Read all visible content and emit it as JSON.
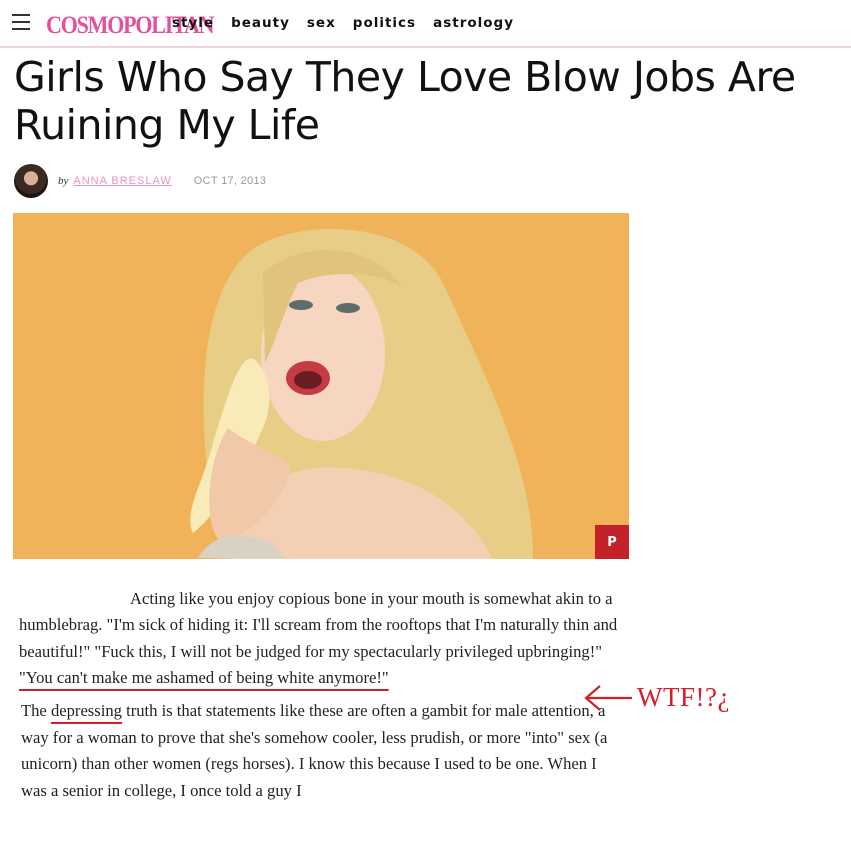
{
  "header": {
    "logo": "COSMOPOLITAN",
    "nav": [
      "style",
      "beauty",
      "sex",
      "politics",
      "astrology"
    ]
  },
  "article": {
    "title": "Girls Who Say They Love Blow Jobs Are Ruining My Life",
    "byline_prefix": "by",
    "author": "ANNA BRESLAW",
    "date": "OCT 17, 2013",
    "pin_label": "P",
    "p1_a": "Acting like you enjoy copious bone in your mouth is somewhat akin to a humblebrag. \"I'm sick of hiding it: I'll scream from the rooftops that I'm naturally thin and beautiful!\" \"Fuck this, I will not be judged for my spectacularly privileged upbringing!\" ",
    "p1_b": "\"You can't make me ashamed of being white anymore!\"",
    "p2_a": "The ",
    "p2_b": "depressing",
    "p2_c": " truth is that statements like these are often a gambit for male attention, a way for a woman to prove that she's somehow cooler, less prudish, or more \"into\" sex (a unicorn) than other women (regs horses). I know this because I used to be one. When I was a senior in college, I once told a guy I"
  },
  "annotation": {
    "text": "WTF!?¿",
    "color": "#d0202a"
  },
  "colors": {
    "brand": "#e4509f",
    "hero_background": "#f0b35a",
    "pin_button": "#c4222b"
  }
}
